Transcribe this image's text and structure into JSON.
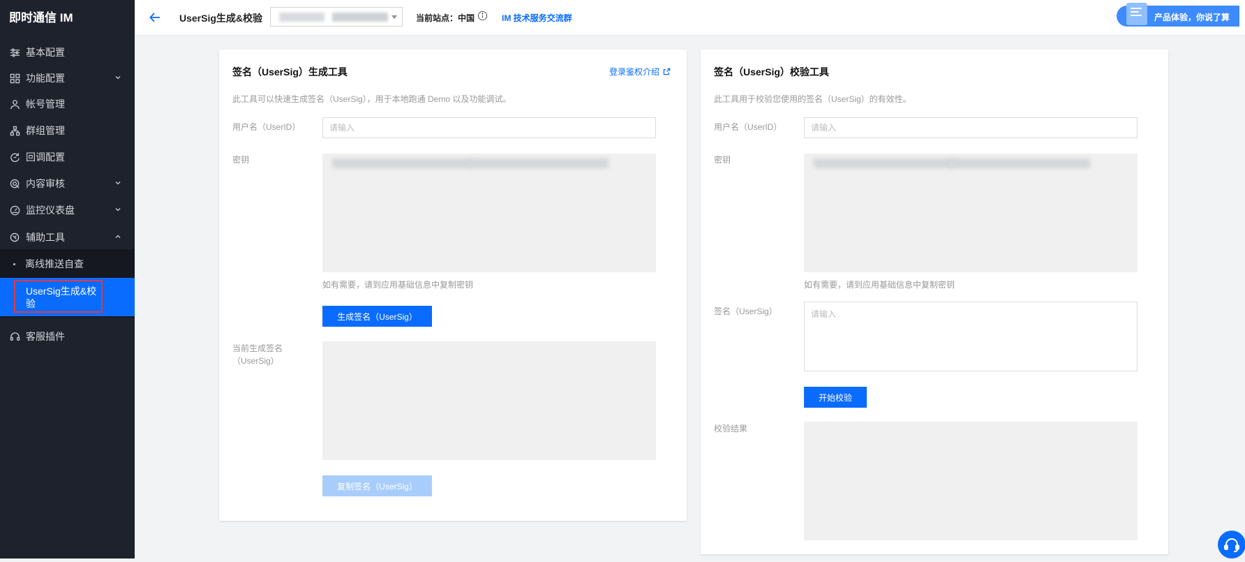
{
  "sidebar": {
    "brand": "即时通信 IM",
    "items": [
      {
        "label": "基本配置",
        "icon": "sliders-icon"
      },
      {
        "label": "功能配置",
        "icon": "grid-icon"
      },
      {
        "label": "帐号管理",
        "icon": "user-icon"
      },
      {
        "label": "群组管理",
        "icon": "group-icon"
      },
      {
        "label": "回调配置",
        "icon": "callback-icon"
      },
      {
        "label": "内容审核",
        "icon": "review-icon"
      },
      {
        "label": "监控仪表盘",
        "icon": "dashboard-icon"
      },
      {
        "label": "辅助工具",
        "icon": "tools-icon"
      },
      {
        "label": "离线推送自查"
      },
      {
        "label": "UserSig生成&校验"
      },
      {
        "label": "客服插件",
        "icon": "headset-icon"
      }
    ]
  },
  "header": {
    "title": "UserSig生成&校验",
    "site_label": "当前站点：中国",
    "group_link": "IM 技术服务交流群",
    "feedback": "产品体验，你说了算"
  },
  "generator": {
    "title": "签名（UserSig）生成工具",
    "auth_link": "登录鉴权介绍",
    "desc": "此工具可以快速生成签名（UserSig），用于本地跑通 Demo 以及功能调试。",
    "userid_label": "用户名（UserID）",
    "userid_placeholder": "请输入",
    "key_label": "密钥",
    "key_hint": "如有需要，请到应用基础信息中复制密钥",
    "generate_button": "生成签名（UserSig）",
    "current_sig_label": "当前生成签名（UserSig）",
    "copy_button": "复制签名（UserSig）"
  },
  "verifier": {
    "title": "签名（UserSig）校验工具",
    "desc": "此工具用于校验您使用的签名（UserSig）的有效性。",
    "userid_label": "用户名（UserID）",
    "userid_placeholder": "请输入",
    "key_label": "密钥",
    "key_hint": "如有需要，请到应用基础信息中复制密钥",
    "sig_label": "签名（UserSig）",
    "sig_placeholder": "请输入",
    "verify_button": "开始校验",
    "result_label": "校验结果"
  },
  "colors": {
    "sidebar_bg": "#1e222d",
    "accent": "#0a6cff",
    "highlight_border": "#e6383c"
  }
}
